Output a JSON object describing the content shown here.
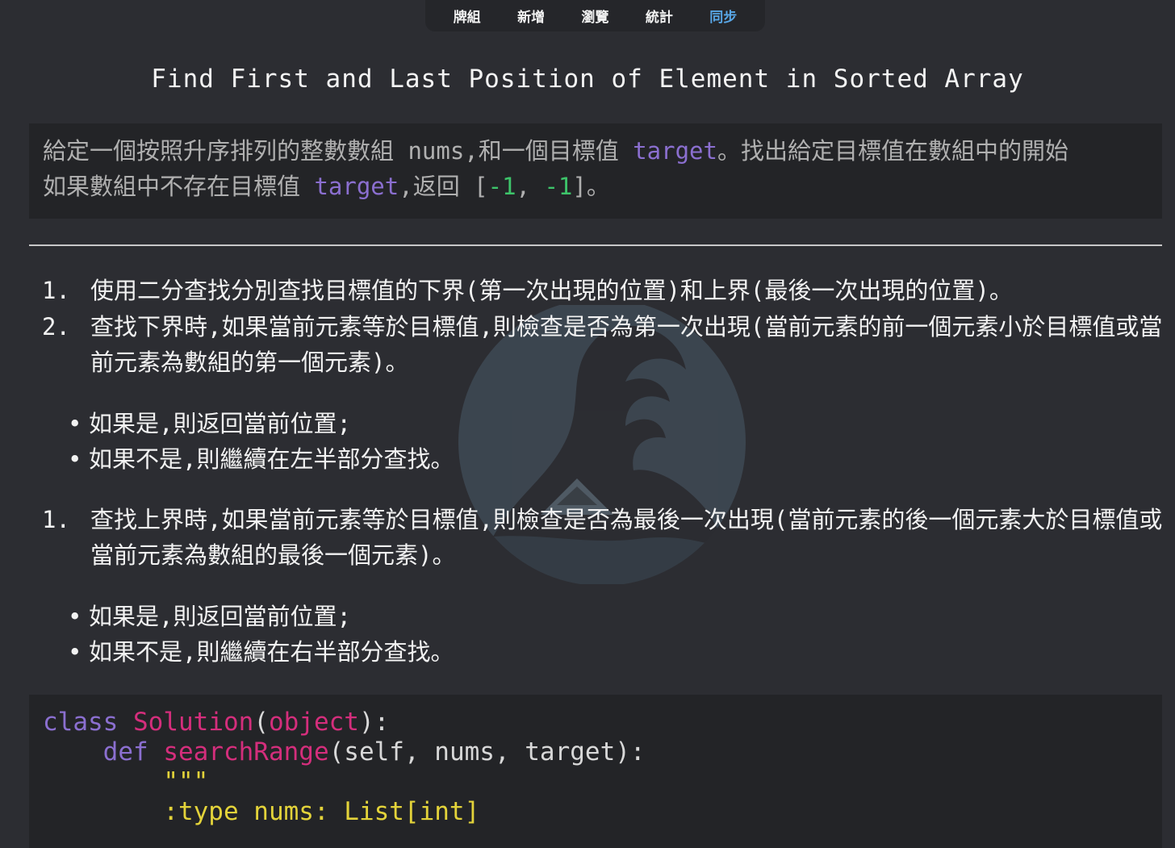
{
  "tabs": [
    {
      "label": "牌組",
      "active": false
    },
    {
      "label": "新增",
      "active": false
    },
    {
      "label": "瀏覽",
      "active": false
    },
    {
      "label": "統計",
      "active": false
    },
    {
      "label": "同步",
      "active": true
    }
  ],
  "card": {
    "title": "Find First and Last Position of Element in Sorted Array",
    "description": {
      "line1": {
        "p1": "給定一個按照升序排列的整數數組 nums,和一個目標值 ",
        "target": "target",
        "p2": "。找出給定目標值在數組中的開始"
      },
      "line2": {
        "p1": "如果數組中不存在目標值 ",
        "target": "target",
        "p2": ",返回 [",
        "neg1a": "-1",
        "sep": ", ",
        "neg1b": "-1",
        "p3": "]。"
      }
    },
    "steps_a": [
      {
        "num": "1.",
        "text": "使用二分查找分別查找目標值的下界(第一次出現的位置)和上界(最後一次出現的位置)。"
      },
      {
        "num": "2.",
        "text": "查找下界時,如果當前元素等於目標值,則檢查是否為第一次出現(當前元素的前一個元素小於目標值或當前元素為數組的第一個元素)。"
      }
    ],
    "bullets_a": [
      "如果是,則返回當前位置;",
      "如果不是,則繼續在左半部分查找。"
    ],
    "steps_b": [
      {
        "num": "1.",
        "text": "查找上界時,如果當前元素等於目標值,則檢查是否為最後一次出現(當前元素的後一個元素大於目標值或當前元素為數組的最後一個元素)。"
      }
    ],
    "bullets_b": [
      "如果是,則返回當前位置;",
      "如果不是,則繼續在右半部分查找。"
    ],
    "code": {
      "l1_kw": "class",
      "l1_name": "Solution",
      "l1_open": "(",
      "l1_base": "object",
      "l1_close": "):",
      "l2_kw": "def",
      "l2_name": "searchRange",
      "l2_args": "(self, nums, target):",
      "l3": "\"\"\"",
      "l4": ":type nums: List[int]"
    }
  },
  "colors": {
    "background": "#2c2d32",
    "accent_tab": "#58a6e6",
    "keyword_purple": "#8b6fd0",
    "number_green": "#3dc46a",
    "code_pink": "#d42e7c",
    "code_yellow": "#e3d33a"
  },
  "icons": [
    "great-wave-watermark-icon"
  ]
}
